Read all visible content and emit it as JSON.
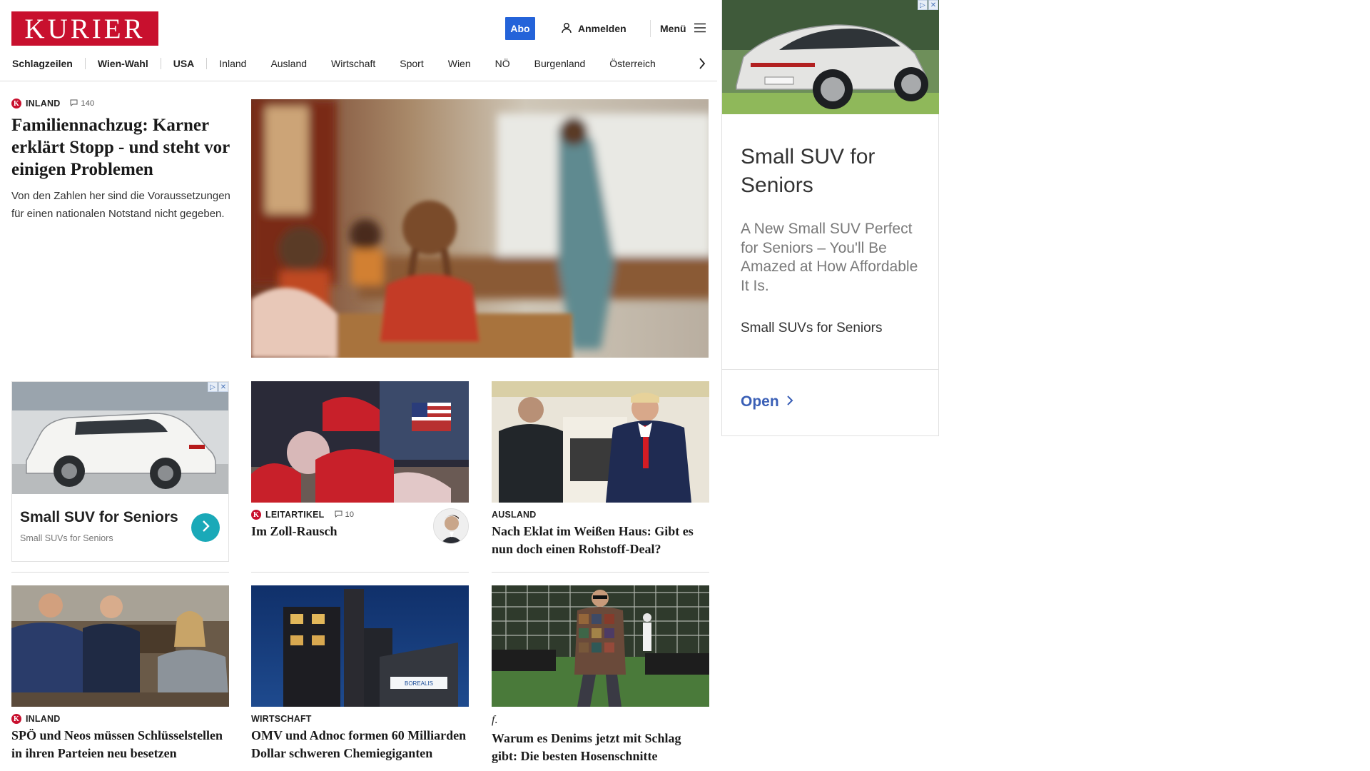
{
  "header": {
    "logo": "KURIER",
    "abo_label": "Abo",
    "login_label": "Anmelden",
    "menu_label": "Menü"
  },
  "nav": {
    "items": [
      "Schlagzeilen",
      "Wien-Wahl",
      "USA",
      "Inland",
      "Ausland",
      "Wirtschaft",
      "Sport",
      "Wien",
      "NÖ",
      "Burgenland",
      "Österreich"
    ]
  },
  "lead": {
    "kicker": "INLAND",
    "comments": "140",
    "title": "Familiennachzug: Karner erklärt Stopp - und steht vor einigen Problemen",
    "teaser": "Von den Zahlen her sind die Voraussetzungen für einen nationalen Notstand nicht gegeben."
  },
  "ad_small": {
    "title": "Small SUV for Seniors",
    "subtitle": "Small SUVs for Seniors"
  },
  "cards": [
    {
      "kicker": "LEITARTIKEL",
      "comments": "10",
      "title": "Im Zoll-Rausch"
    },
    {
      "kicker": "AUSLAND",
      "title": "Nach Eklat im Weißen Haus: Gibt es nun doch einen Rohstoff-Deal?"
    },
    {
      "kicker": "INLAND",
      "title": "SPÖ und Neos müssen Schlüsselstellen in ihren Parteien neu besetzen"
    },
    {
      "kicker": "WIRTSCHAFT",
      "title": "OMV und Adnoc formen 60 Milliarden Dollar schweren Chemiegiganten"
    },
    {
      "kicker": "f.",
      "title": "Warum es Denims jetzt mit Schlag gibt: Die besten Hosenschnitte"
    }
  ],
  "image_texts": {
    "borealis_sign": "BOREALIS"
  },
  "ad_right": {
    "title": "Small SUV for Seniors",
    "description": "A New Small SUV Perfect for Seniors – You'll Be Amazed at How Affordable It Is.",
    "brand": "Small SUVs for Seniors",
    "cta": "Open"
  },
  "colors": {
    "brand_red": "#c8102e",
    "abo_blue": "#2463d9",
    "ad_teal": "#1aa9b8",
    "ad_link_blue": "#3a5fb6"
  }
}
